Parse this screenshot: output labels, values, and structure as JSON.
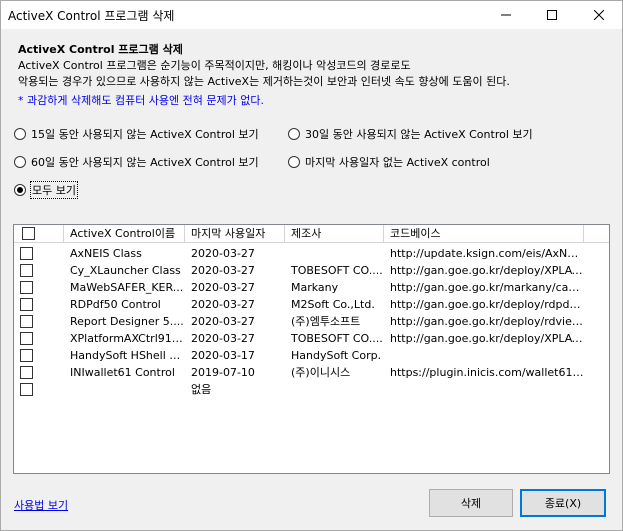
{
  "window": {
    "title": "ActiveX Control 프로그램 삭제"
  },
  "header": {
    "title": "ActiveX Control 프로그램 삭제",
    "desc1": "ActiveX Control 프로그램은 순기능이 주목적이지만, 해킹이나 악성코드의 경로로도",
    "desc2": "악용되는 경우가 있으므로 사용하지 않는 ActiveX는 제거하는것이 보안과 인터넷 속도 향상에 도움이 된다.",
    "note": "* 과감하게 삭제해도 컴퓨터 사용엔 전혀 문제가 없다."
  },
  "filters": [
    {
      "label": "15일 동안 사용되지 않는 ActiveX Control 보기",
      "selected": false
    },
    {
      "label": "30일 동안 사용되지 않는 ActiveX Control 보기",
      "selected": false
    },
    {
      "label": "60일 동안 사용되지 않는 ActiveX Control 보기",
      "selected": false
    },
    {
      "label": "마지막 사용일자 없는 ActiveX control",
      "selected": false
    },
    {
      "label": "모두 보기",
      "selected": true
    }
  ],
  "table": {
    "columns": [
      "",
      "ActiveX Control이름",
      "마지막 사용일자",
      "제조사",
      "코드베이스"
    ],
    "rows": [
      {
        "name": "AxNEIS Class",
        "date": "2020-03-27",
        "vendor": "",
        "codebase": "http://update.ksign.com/eis/AxNEIS..."
      },
      {
        "name": "Cy_XLauncher Class",
        "date": "2020-03-27",
        "vendor": "TOBESOFT CO....",
        "codebase": "http://gan.goe.go.kr/deploy/XPLAT..."
      },
      {
        "name": "MaWebSAFER_KER...",
        "date": "2020-03-27",
        "vendor": "Markany",
        "codebase": "http://gan.goe.go.kr/markany/cab/..."
      },
      {
        "name": "RDPdf50 Control",
        "date": "2020-03-27",
        "vendor": "M2Soft Co.,Ltd.",
        "codebase": "http://gan.goe.go.kr/deploy/rdpdf5..."
      },
      {
        "name": "Report Designer 5....",
        "date": "2020-03-27",
        "vendor": "(주)엠투소프트",
        "codebase": "http://gan.goe.go.kr/deploy/rdview..."
      },
      {
        "name": "XPlatformAXCtrl91 ...",
        "date": "2020-03-27",
        "vendor": "TOBESOFT CO....",
        "codebase": "http://gan.goe.go.kr/deploy/XPLAT..."
      },
      {
        "name": "HandySoft HShell W...",
        "date": "2020-03-17",
        "vendor": "HandySoft Corp.",
        "codebase": ""
      },
      {
        "name": "INIwallet61 Control",
        "date": "2019-07-10",
        "vendor": "(주)이니시스",
        "codebase": "https://plugin.inicis.com/wallet61/IN..."
      },
      {
        "name": "",
        "date": "없음",
        "vendor": "",
        "codebase": ""
      }
    ]
  },
  "footer": {
    "help_link": "사용법 보기",
    "delete_label": "삭제",
    "close_label": "종료(X)"
  }
}
